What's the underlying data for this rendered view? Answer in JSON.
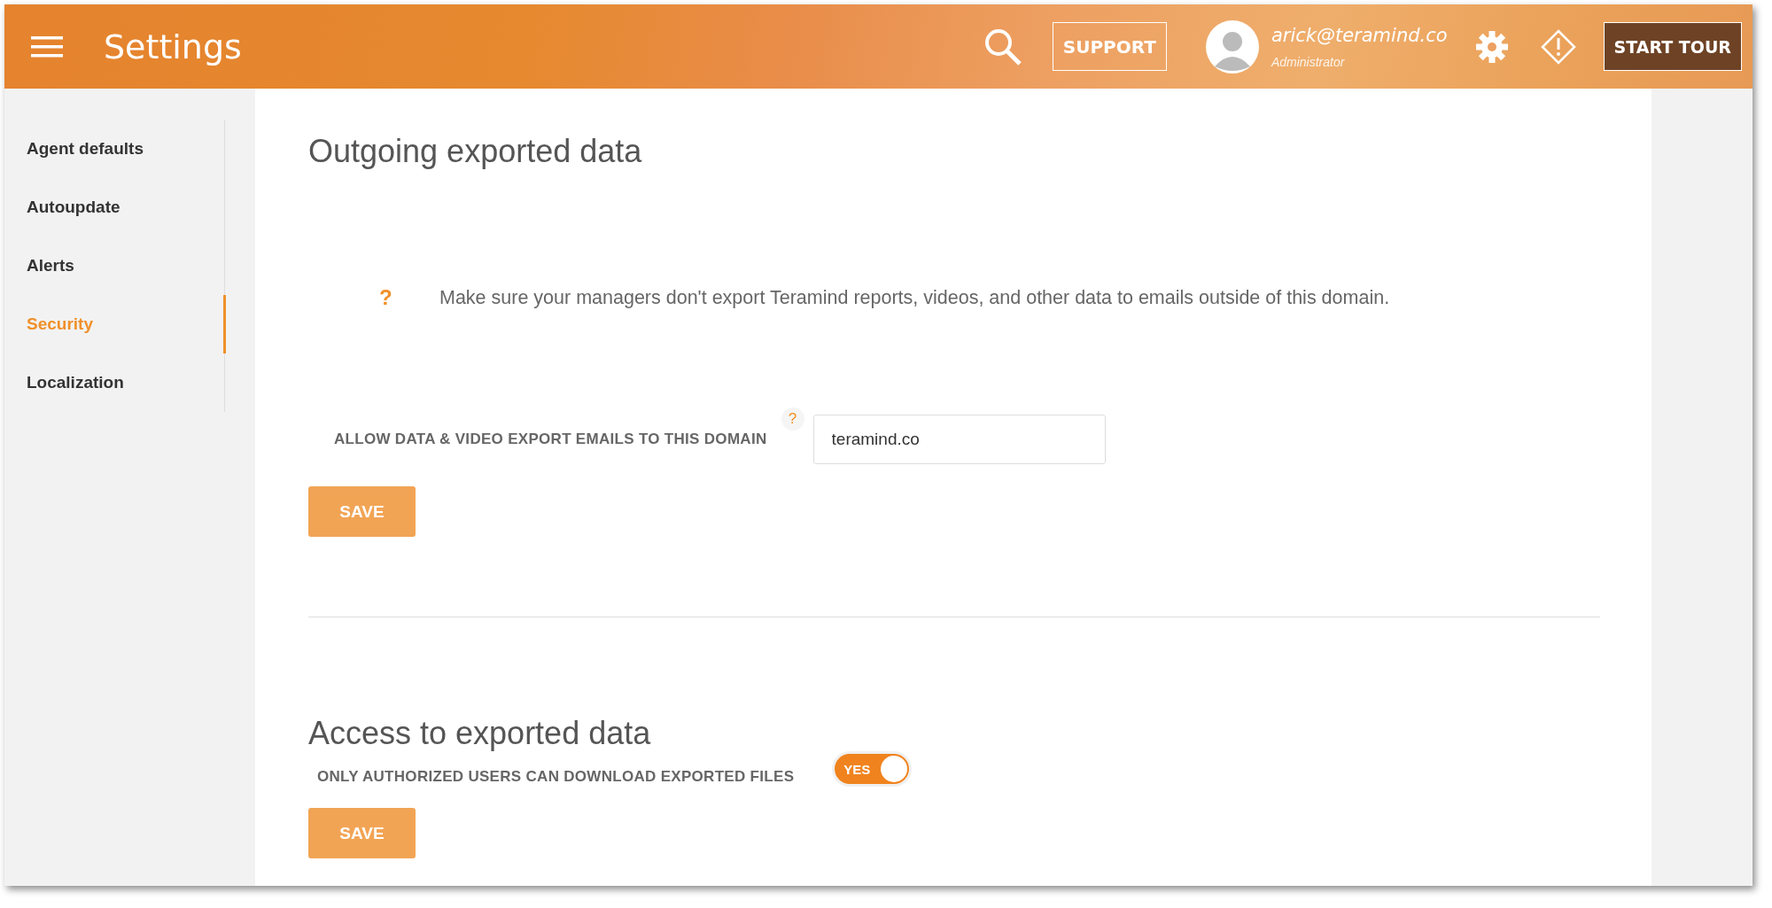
{
  "header": {
    "title": "Settings",
    "support_label": "SUPPORT",
    "user_email": "arick@teramind.co",
    "user_role": "Administrator",
    "tour_label": "START TOUR"
  },
  "sidebar": {
    "items": [
      {
        "label": "Agent defaults",
        "selected": false
      },
      {
        "label": "Autoupdate",
        "selected": false
      },
      {
        "label": "Alerts",
        "selected": false
      },
      {
        "label": "Security",
        "selected": true
      },
      {
        "label": "Localization",
        "selected": false
      }
    ]
  },
  "sections": [
    {
      "title": "Outgoing exported data",
      "help_mark": "?",
      "help_text": "Make sure your managers don't export Teramind reports, videos, and other data to emails outside of this domain.",
      "field_label": "ALLOW DATA & VIDEO EXPORT EMAILS TO THIS DOMAIN",
      "field_help": "?",
      "field_value": "teramind.co",
      "button": "SAVE"
    },
    {
      "title": "Access to exported data",
      "toggle_label": "ONLY AUTHORIZED USERS CAN DOWNLOAD EXPORTED FILES",
      "toggle_on": true,
      "toggle_text": "YES",
      "button": "SAVE"
    }
  ]
}
